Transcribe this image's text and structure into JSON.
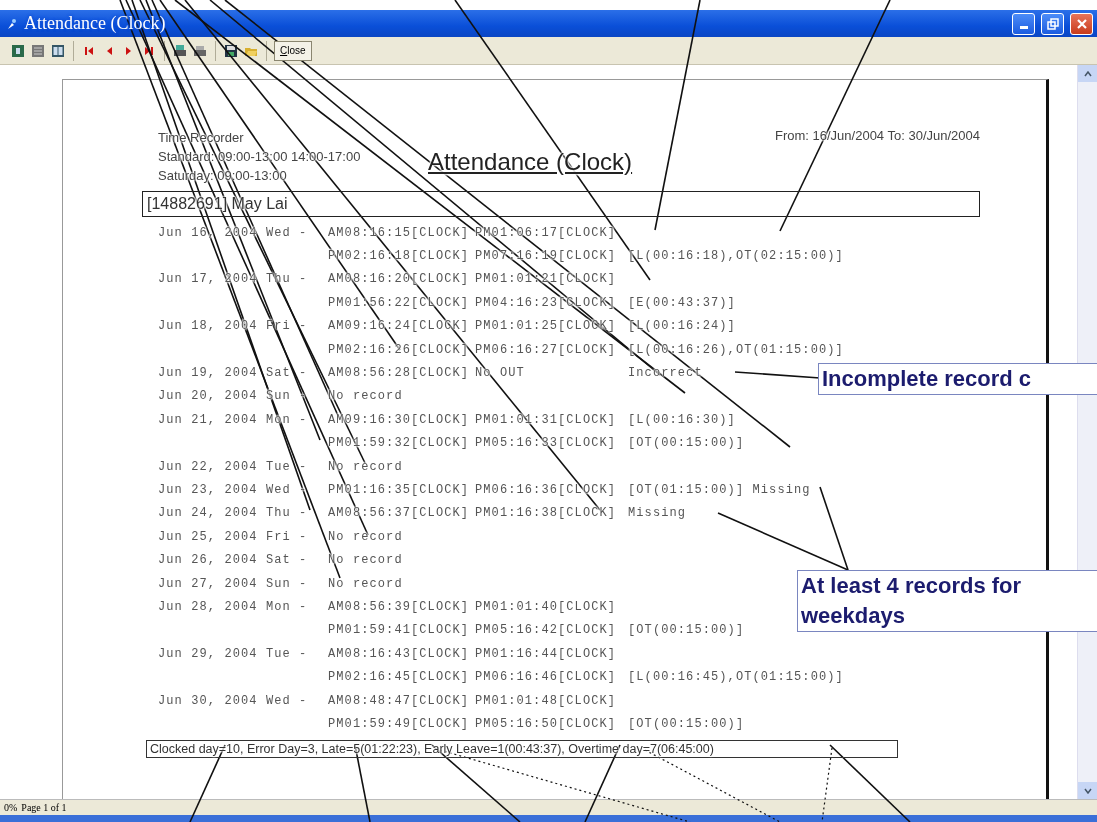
{
  "window": {
    "title": "Attendance (Clock)"
  },
  "toolbar": {
    "close_label": "Close"
  },
  "report": {
    "header_lines": [
      "Time Recorder",
      "Standard: 09:00-13:00 14:00-17:00",
      "Saturday: 09:00-13:00"
    ],
    "title": "Attendance (Clock)",
    "period": "From: 16/Jun/2004 To: 30/Jun/2004",
    "employee": "[14882691] May Lai",
    "days": [
      {
        "date": "Jun 16, 2004 Wed -",
        "lines": [
          [
            "AM08:16:15[CLOCK]",
            "PM01:06:17[CLOCK]"
          ],
          [
            "PM02:16:18[CLOCK]",
            "PM07:16:19[CLOCK]",
            "[L(00:16:18),OT(02:15:00)]"
          ]
        ]
      },
      {
        "date": "Jun 17, 2004 Thu -",
        "lines": [
          [
            "AM08:16:20[CLOCK]",
            "PM01:01:21[CLOCK]"
          ],
          [
            "PM01:56:22[CLOCK]",
            "PM04:16:23[CLOCK]",
            "[E(00:43:37)]"
          ]
        ]
      },
      {
        "date": "Jun 18, 2004 Fri -",
        "lines": [
          [
            "AM09:16:24[CLOCK]",
            "PM01:01:25[CLOCK]",
            "[L(00:16:24)]"
          ],
          [
            "PM02:16:26[CLOCK]",
            "PM06:16:27[CLOCK]",
            "[L(00:16:26),OT(01:15:00)]"
          ]
        ]
      },
      {
        "date": "Jun 19, 2004 Sat -",
        "lines": [
          [
            "AM08:56:28[CLOCK]",
            "No OUT",
            "Incorrect"
          ]
        ]
      },
      {
        "date": "Jun 20, 2004 Sun -",
        "lines": [
          [
            "No record"
          ]
        ]
      },
      {
        "date": "Jun 21, 2004 Mon -",
        "lines": [
          [
            "AM09:16:30[CLOCK]",
            "PM01:01:31[CLOCK]",
            "[L(00:16:30)]"
          ],
          [
            "PM01:59:32[CLOCK]",
            "PM05:16:33[CLOCK]",
            "[OT(00:15:00)]"
          ]
        ]
      },
      {
        "date": "Jun 22, 2004 Tue -",
        "lines": [
          [
            "No record"
          ]
        ]
      },
      {
        "date": "Jun 23, 2004 Wed -",
        "lines": [
          [
            "PM01:16:35[CLOCK]",
            "PM06:16:36[CLOCK]",
            "[OT(01:15:00)] Missing"
          ]
        ]
      },
      {
        "date": "Jun 24, 2004 Thu -",
        "lines": [
          [
            "AM08:56:37[CLOCK]",
            "PM01:16:38[CLOCK]",
            "Missing"
          ]
        ]
      },
      {
        "date": "Jun 25, 2004 Fri -",
        "lines": [
          [
            "No record"
          ]
        ]
      },
      {
        "date": "Jun 26, 2004 Sat -",
        "lines": [
          [
            "No record"
          ]
        ]
      },
      {
        "date": "Jun 27, 2004 Sun -",
        "lines": [
          [
            "No record"
          ]
        ]
      },
      {
        "date": "Jun 28, 2004 Mon -",
        "lines": [
          [
            "AM08:56:39[CLOCK]",
            "PM01:01:40[CLOCK]"
          ],
          [
            "PM01:59:41[CLOCK]",
            "PM05:16:42[CLOCK]",
            "[OT(00:15:00)]"
          ]
        ]
      },
      {
        "date": "Jun 29, 2004 Tue -",
        "lines": [
          [
            "AM08:16:43[CLOCK]",
            "PM01:16:44[CLOCK]"
          ],
          [
            "PM02:16:45[CLOCK]",
            "PM06:16:46[CLOCK]",
            "[L(00:16:45),OT(01:15:00)]"
          ]
        ]
      },
      {
        "date": "Jun 30, 2004 Wed -",
        "lines": [
          [
            "AM08:48:47[CLOCK]",
            "PM01:01:48[CLOCK]"
          ],
          [
            "PM01:59:49[CLOCK]",
            "PM05:16:50[CLOCK]",
            "[OT(00:15:00)]"
          ]
        ]
      }
    ],
    "summary": "Clocked day=10, Error Day=3, Late=5(01:22:23), Early Leave=1(00:43:37), Overtime day=7(06:45:00)"
  },
  "callouts": [
    "Incomplete record c",
    "At least 4 records for weekdays"
  ],
  "status_bar": {
    "zoom": "0%",
    "page": "Page 1 of 1"
  }
}
